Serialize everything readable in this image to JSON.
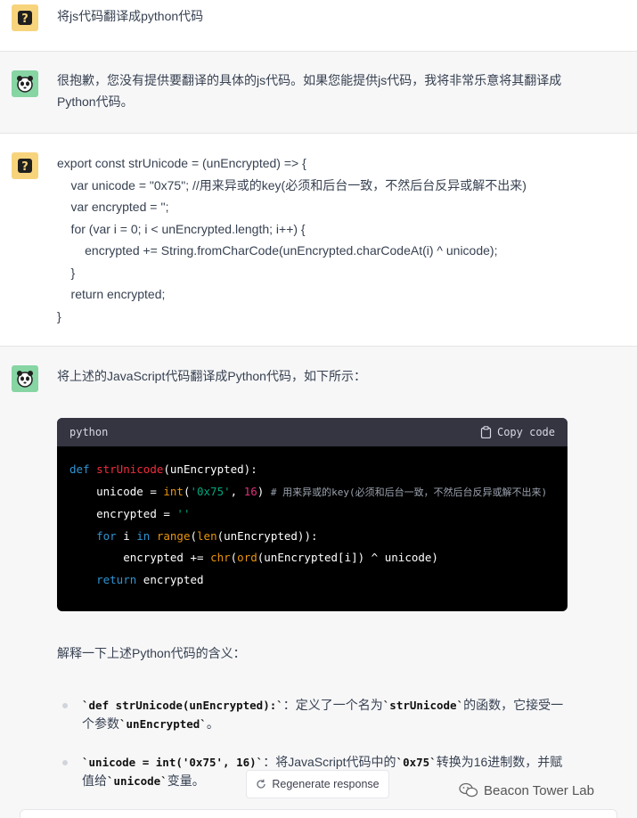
{
  "messages": {
    "m1_user": "将js代码翻译成python代码",
    "m2_bot_line1": "很抱歉，您没有提供要翻译的具体的js代码。如果您能提供js代码，我将非常乐意将其翻译成",
    "m2_bot_line2": "Python代码。",
    "m3_user_code": [
      "export const strUnicode = (unEncrypted) => {",
      "    var unicode = \"0x75\"; //用来异或的key(必须和后台一致，不然后台反异或解不出来)",
      "    var encrypted = '';",
      "    for (var i = 0; i < unEncrypted.length; i++) {",
      "        encrypted += String.fromCharCode(unEncrypted.charCodeAt(i) ^ unicode);",
      "    }",
      "    return encrypted;",
      "}"
    ],
    "m4_bot_intro": "将上述的JavaScript代码翻译成Python代码，如下所示：",
    "m4_explain_heading": "解释一下上述Python代码的含义："
  },
  "code_block": {
    "language": "python",
    "copy_label": "Copy code",
    "l1_kw": "def",
    "l1_fn": "strUnicode",
    "l1_rest": "(unEncrypted):",
    "l2_a": "unicode = ",
    "l2_int": "int",
    "l2_str": "'0x75'",
    "l2_num": "16",
    "l2_comment": "# 用来异或的key(必须和后台一致，不然后台反异或解不出来)",
    "l3_a": "encrypted = ",
    "l3_str": "''",
    "l4_for": "for",
    "l4_i": " i ",
    "l4_in": "in",
    "l4_range": "range",
    "l4_len": "len",
    "l4_rest": "(unEncrypted)):",
    "l5_a": "encrypted += ",
    "l5_chr": "chr",
    "l5_ord": "ord",
    "l5_rest": "(unEncrypted[i]) ^ unicode)",
    "l6_return": "return",
    "l6_rest": " encrypted"
  },
  "bullets": [
    {
      "code": "`def strUnicode(unEncrypted):`",
      "text_a": "：定义了一个名为",
      "code2": "`strUnicode`",
      "text_b": "的函数，它接受一",
      "line2_a": "个参数",
      "line2_code": "`unEncrypted`",
      "line2_b": "。"
    },
    {
      "code": "`unicode = int('0x75', 16)`",
      "text_a": "：将JavaScript代码中的",
      "code2": "`0x75`",
      "text_b": "转换为16进制数，并赋",
      "line2_a": "值给",
      "line2_code": "`unicode`",
      "line2_b": "变量。"
    }
  ],
  "regenerate_label": "Regenerate response",
  "watermark": "Beacon Tower Lab",
  "colors": {
    "user_avatar": "#f7d47c",
    "bot_avatar": "#86d5a3",
    "code_bg": "#000000",
    "code_header": "#343541"
  }
}
